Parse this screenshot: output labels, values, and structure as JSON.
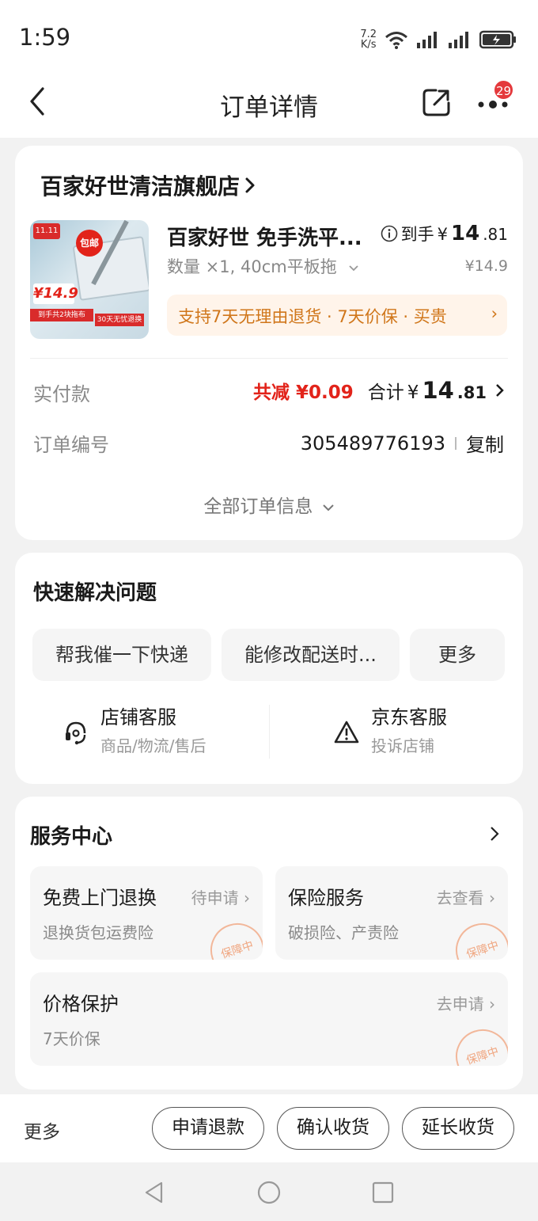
{
  "status_bar": {
    "time": "1:59",
    "net_speed_value": "7.2",
    "net_speed_unit": "K/s",
    "icons": [
      "wifi-icon",
      "signal-icon",
      "signal-icon",
      "battery-icon"
    ]
  },
  "header": {
    "title": "订单详情",
    "badge_count": "29",
    "icons": [
      "back-icon",
      "share-icon",
      "more-icon"
    ]
  },
  "order_card": {
    "shop_name": "百家好世清洁旗舰店",
    "product": {
      "name": "百家好世 免手洗平...",
      "spec": "数量 ×1, 40cm平板拖",
      "price_label": "到手",
      "price_currency": "¥",
      "price_integer": "14",
      "price_decimal": ".81",
      "original_price": "¥14.9",
      "image_texts": {
        "logo": "11.11",
        "tag": "包邮",
        "price": "¥14.9",
        "strip": "到手共2块拖布",
        "strip2": "30天无忧退换"
      },
      "promise_text": "支持7天无理由退货 · 7天价保 · 买贵",
      "promise_chevron": "›"
    },
    "payment": {
      "label": "实付款",
      "discount": "共减 ¥0.09",
      "total_label": "合计",
      "total_currency": "¥",
      "total_integer": "14",
      "total_decimal": ".81"
    },
    "order_number": {
      "label": "订单编号",
      "value": "305489776193",
      "copy_label": "复制"
    },
    "all_info_label": "全部订单信息"
  },
  "quick_help": {
    "title": "快速解决问题",
    "chips": [
      "帮我催一下快递",
      "能修改配送时...",
      "更多"
    ],
    "store_service": {
      "title": "店铺客服",
      "subtitle": "商品/物流/售后"
    },
    "jd_service": {
      "title": "京东客服",
      "subtitle": "投诉店铺"
    }
  },
  "service_center": {
    "title": "服务中心",
    "tiles": [
      {
        "title": "免费上门退换",
        "action": "待申请 ›",
        "subtitle": "退换货包运费险",
        "stamp": "保障中"
      },
      {
        "title": "保险服务",
        "action": "去查看 ›",
        "subtitle": "破损险、产责险",
        "stamp": "保障中"
      },
      {
        "title": "价格保护",
        "action": "去申请 ›",
        "subtitle": "7天价保",
        "stamp": "保障中"
      }
    ]
  },
  "bottom_bar": {
    "more_label": "更多",
    "buttons": [
      "申请退款",
      "确认收货",
      "延长收货"
    ]
  },
  "colors": {
    "accent_red": "#e2231a",
    "promise_orange": "#d0761a",
    "promise_bg": "#fff4ea",
    "page_bg": "#f2f2f2"
  }
}
